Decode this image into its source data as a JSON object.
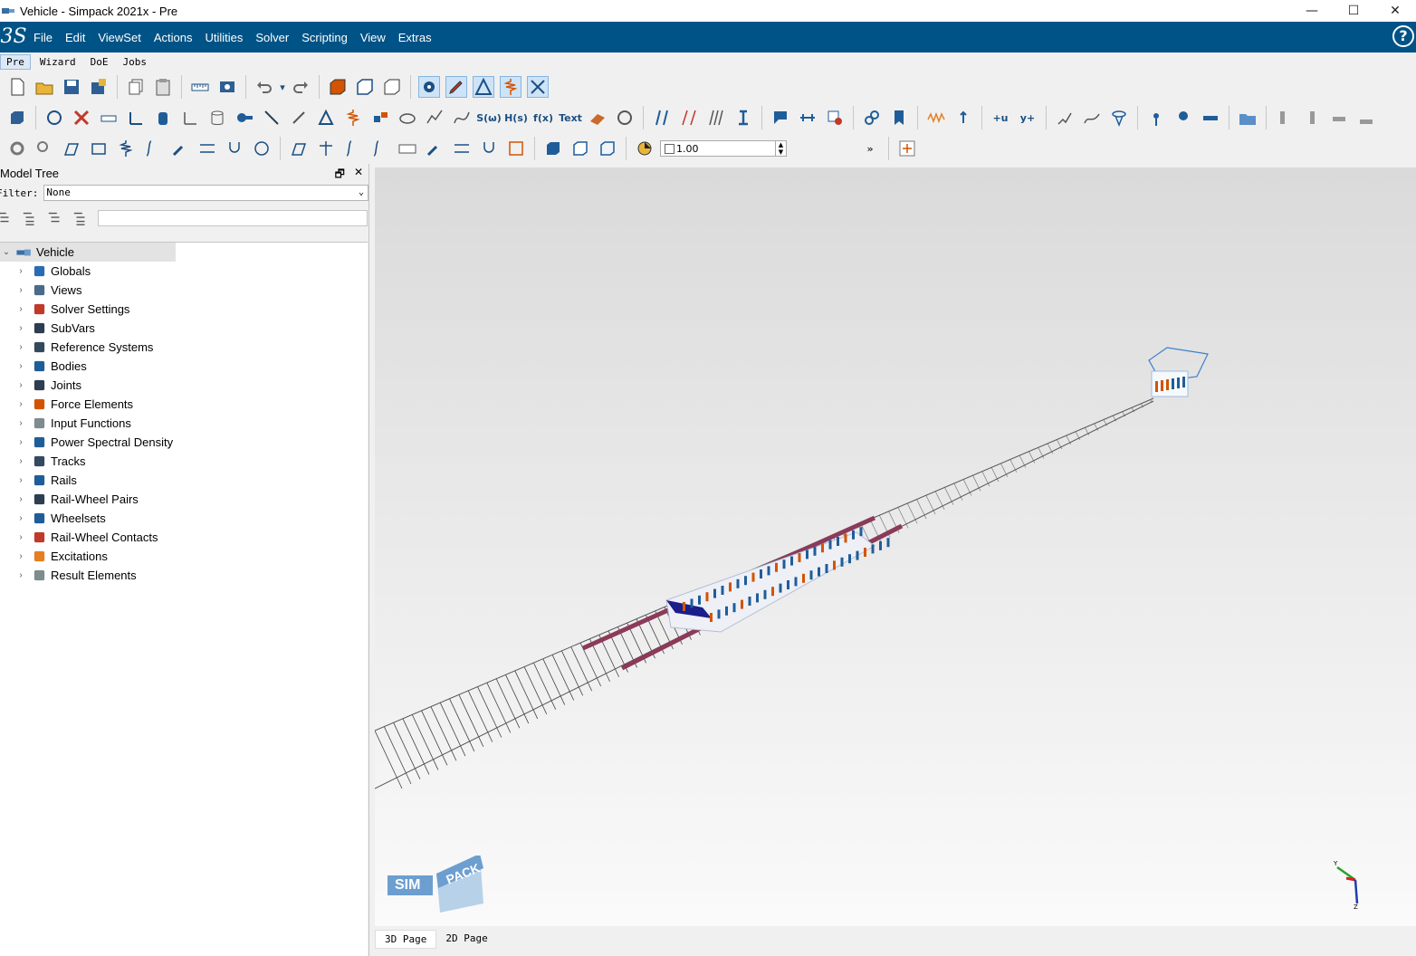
{
  "window": {
    "title": "Vehicle - Simpack 2021x - Pre",
    "minimize": "—",
    "maximize": "☐",
    "close": "✕"
  },
  "menubar": {
    "logo": "3S",
    "items": [
      "File",
      "Edit",
      "ViewSet",
      "Actions",
      "Utilities",
      "Solver",
      "Scripting",
      "View",
      "Extras"
    ],
    "help": "?"
  },
  "modes": [
    "Pre",
    "Wizard",
    "DoE",
    "Jobs"
  ],
  "toolbar": {
    "text_buttons": {
      "s_omega": "S(ω)",
      "h_s": "H(s)",
      "f_x": "f(x)",
      "text": "Text",
      "plus_u": "+u",
      "y_plus": "y+"
    },
    "zoom_value": "1.00",
    "overflow": "»"
  },
  "model_tree": {
    "title": "Model Tree",
    "float_icon": "🗗",
    "close_icon": "✕",
    "filter_label": "Filter:",
    "filter_value": "None",
    "root": "Vehicle",
    "items": [
      {
        "label": "Globals",
        "icon": "globe-icon",
        "color": "#2a6bb5"
      },
      {
        "label": "Views",
        "icon": "views-icon",
        "color": "#4a6b8a"
      },
      {
        "label": "Solver Settings",
        "icon": "solver-settings-icon",
        "color": "#c0392b"
      },
      {
        "label": "SubVars",
        "icon": "subvars-icon",
        "color": "#2c3e50"
      },
      {
        "label": "Reference Systems",
        "icon": "reference-systems-icon",
        "color": "#34495e"
      },
      {
        "label": "Bodies",
        "icon": "bodies-icon",
        "color": "#1f5d99"
      },
      {
        "label": "Joints",
        "icon": "joints-icon",
        "color": "#2c3e50"
      },
      {
        "label": "Force Elements",
        "icon": "force-elements-icon",
        "color": "#d35400"
      },
      {
        "label": "Input Functions",
        "icon": "input-functions-icon",
        "color": "#7f8c8d"
      },
      {
        "label": "Power Spectral Density",
        "icon": "psd-icon",
        "color": "#1f5d99"
      },
      {
        "label": "Tracks",
        "icon": "tracks-icon",
        "color": "#34495e"
      },
      {
        "label": "Rails",
        "icon": "rails-icon",
        "color": "#1f5d99"
      },
      {
        "label": "Rail-Wheel Pairs",
        "icon": "rail-wheel-pairs-icon",
        "color": "#2c3e50"
      },
      {
        "label": "Wheelsets",
        "icon": "wheelsets-icon",
        "color": "#1f5d99"
      },
      {
        "label": "Rail-Wheel Contacts",
        "icon": "rail-wheel-contacts-icon",
        "color": "#c0392b"
      },
      {
        "label": "Excitations",
        "icon": "excitations-icon",
        "color": "#e67e22"
      },
      {
        "label": "Result Elements",
        "icon": "result-elements-icon",
        "color": "#7f8c8d"
      }
    ]
  },
  "viewport": {
    "logo_sim": "SIM",
    "logo_pack": "PACK",
    "axis_labels": {
      "y": "Y",
      "z": "Z"
    }
  },
  "pages": [
    "3D Page",
    "2D Page"
  ],
  "colors": {
    "brand": "#005386",
    "rail": "#8b3a5a",
    "track": "#555555"
  }
}
